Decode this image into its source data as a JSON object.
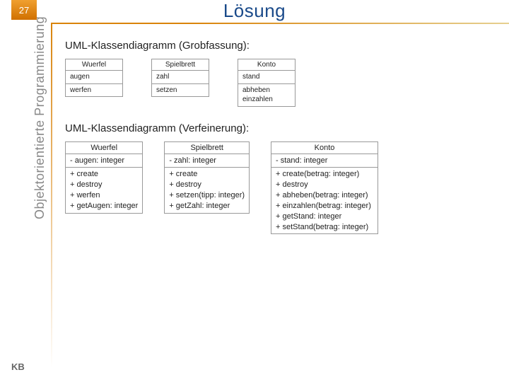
{
  "page": {
    "number": "27",
    "title": "Lösung",
    "sidebar": "Objektorientierte Programmierung",
    "footer": "KB"
  },
  "sections": {
    "grob": {
      "heading": "UML-Klassendiagramm (Grobfassung):",
      "classes": [
        {
          "name": "Wuerfel",
          "attrs": [
            "augen"
          ],
          "ops": [
            "werfen"
          ]
        },
        {
          "name": "Spielbrett",
          "attrs": [
            "zahl"
          ],
          "ops": [
            "setzen"
          ]
        },
        {
          "name": "Konto",
          "attrs": [
            "stand"
          ],
          "ops": [
            "abheben",
            "einzahlen"
          ]
        }
      ]
    },
    "verf": {
      "heading": "UML-Klassendiagramm (Verfeinerung):",
      "classes": [
        {
          "name": "Wuerfel",
          "attrs": [
            "- augen: integer"
          ],
          "ops": [
            "+ create",
            "+ destroy",
            "+ werfen",
            "+ getAugen: integer"
          ]
        },
        {
          "name": "Spielbrett",
          "attrs": [
            "- zahl: integer"
          ],
          "ops": [
            "+ create",
            "+ destroy",
            "+ setzen(tipp: integer)",
            "+ getZahl: integer"
          ]
        },
        {
          "name": "Konto",
          "attrs": [
            "- stand: integer"
          ],
          "ops": [
            "+ create(betrag: integer)",
            "+ destroy",
            "+ abheben(betrag: integer)",
            "+ einzahlen(betrag: integer)",
            "+ getStand: integer",
            "+ setStand(betrag: integer)"
          ]
        }
      ]
    }
  }
}
